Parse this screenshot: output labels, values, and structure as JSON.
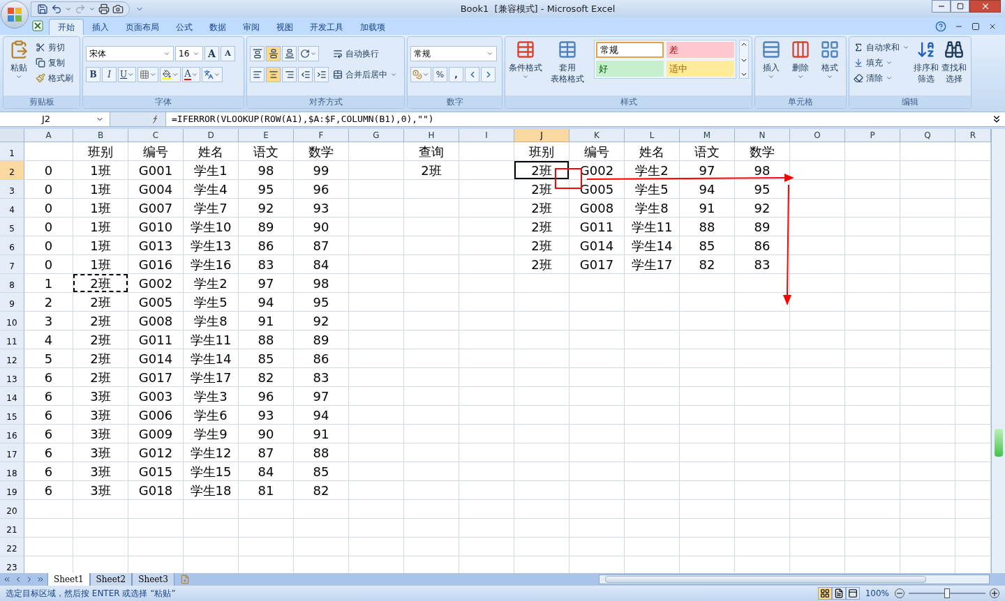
{
  "title_bar": {
    "title": "Book1  [兼容模式] - Microsoft Excel"
  },
  "ribbon_tabs": [
    {
      "label": "开始",
      "selected": true
    },
    {
      "label": "插入",
      "selected": false
    },
    {
      "label": "页面布局",
      "selected": false
    },
    {
      "label": "公式",
      "selected": false
    },
    {
      "label": "数据",
      "selected": false
    },
    {
      "label": "审阅",
      "selected": false
    },
    {
      "label": "视图",
      "selected": false
    },
    {
      "label": "开发工具",
      "selected": false
    },
    {
      "label": "加载项",
      "selected": false
    }
  ],
  "clipboard": {
    "label": "剪贴板",
    "paste": "粘贴",
    "items": [
      "剪切",
      "复制",
      "格式刷"
    ]
  },
  "font": {
    "label": "字体",
    "font_name": "宋体",
    "font_size": "16",
    "grow": "A",
    "shrink": "A",
    "bold": "B",
    "italic": "I",
    "underline": "U",
    "font_color": "A"
  },
  "alignment": {
    "label": "对齐方式",
    "wrap_text": "自动换行",
    "merge_center": "合并后居中"
  },
  "number": {
    "label": "数字",
    "format": "常规",
    "percent": "%",
    "comma": ","
  },
  "styles": {
    "label": "样式",
    "conditional_formatting": "条件格式",
    "format_as_table": [
      "套用",
      "表格格式"
    ],
    "cell_styles": [
      {
        "label": "常规",
        "color": "#ffffff"
      },
      {
        "label": "差",
        "color": "#ffc7ce"
      },
      {
        "label": "好",
        "color": "#c6efce"
      },
      {
        "label": "适中",
        "color": "#ffeb9c"
      }
    ]
  },
  "cells": {
    "label": "单元格",
    "buttons": [
      "插入",
      "删除",
      "格式"
    ]
  },
  "editing": {
    "label": "编辑",
    "items": [
      "自动求和",
      "填充",
      "清除"
    ],
    "sort_filter": [
      "排序和",
      "筛选"
    ],
    "find_select": [
      "查找和",
      "选择"
    ]
  },
  "formula_bar": {
    "name_box": "J2",
    "formula": "=IFERROR(VLOOKUP(ROW(A1),$A:$F,COLUMN(B1),0),\"\")"
  },
  "sheet": {
    "columns": [
      {
        "label": "A",
        "selected": false
      },
      {
        "label": "B",
        "selected": false
      },
      {
        "label": "C",
        "selected": false
      },
      {
        "label": "D",
        "selected": false
      },
      {
        "label": "E",
        "selected": false
      },
      {
        "label": "F",
        "selected": false
      },
      {
        "label": "G",
        "selected": false
      },
      {
        "label": "H",
        "selected": false
      },
      {
        "label": "I",
        "selected": false
      },
      {
        "label": "J",
        "selected": true
      },
      {
        "label": "K",
        "selected": false
      },
      {
        "label": "L",
        "selected": false
      },
      {
        "label": "M",
        "selected": false
      },
      {
        "label": "N",
        "selected": false
      },
      {
        "label": "O",
        "selected": false
      },
      {
        "label": "P",
        "selected": false
      },
      {
        "label": "Q",
        "selected": false
      },
      {
        "label": "R",
        "selected": false
      }
    ],
    "rows": [
      {
        "label": "1",
        "selected": false,
        "cells": {
          "B": "班别",
          "C": "编号",
          "D": "姓名",
          "E": "语文",
          "F": "数学",
          "H": "查询",
          "J": "班别",
          "K": "编号",
          "L": "姓名",
          "M": "语文",
          "N": "数学"
        }
      },
      {
        "label": "2",
        "selected": true,
        "cells": {
          "A": "0",
          "B": "1班",
          "C": "G001",
          "D": "学生1",
          "E": "98",
          "F": "99",
          "H": "2班",
          "J": {
            "text": "2班",
            "active": true,
            "copied": false
          },
          "K": "G002",
          "L": "学生2",
          "M": "97",
          "N": "98"
        }
      },
      {
        "label": "3",
        "selected": false,
        "cells": {
          "A": "0",
          "B": "1班",
          "C": "G004",
          "D": "学生4",
          "E": "95",
          "F": "96",
          "J": "2班",
          "K": "G005",
          "L": "学生5",
          "M": "94",
          "N": "95"
        }
      },
      {
        "label": "4",
        "selected": false,
        "cells": {
          "A": "0",
          "B": "1班",
          "C": "G007",
          "D": "学生7",
          "E": "92",
          "F": "93",
          "J": "2班",
          "K": "G008",
          "L": "学生8",
          "M": "91",
          "N": "92"
        }
      },
      {
        "label": "5",
        "selected": false,
        "cells": {
          "A": "0",
          "B": "1班",
          "C": "G010",
          "D": "学生10",
          "E": "89",
          "F": "90",
          "J": "2班",
          "K": "G011",
          "L": "学生11",
          "M": "88",
          "N": "89"
        }
      },
      {
        "label": "6",
        "selected": false,
        "cells": {
          "A": "0",
          "B": "1班",
          "C": "G013",
          "D": "学生13",
          "E": "86",
          "F": "87",
          "J": "2班",
          "K": "G014",
          "L": "学生14",
          "M": "85",
          "N": "86"
        }
      },
      {
        "label": "7",
        "selected": false,
        "cells": {
          "A": "0",
          "B": "1班",
          "C": "G016",
          "D": "学生16",
          "E": "83",
          "F": "84",
          "J": "2班",
          "K": "G017",
          "L": "学生17",
          "M": "82",
          "N": "83"
        }
      },
      {
        "label": "8",
        "selected": false,
        "cells": {
          "A": "1",
          "B": {
            "text": "2班",
            "active": false,
            "copied": true
          },
          "C": "G002",
          "D": "学生2",
          "E": "97",
          "F": "98"
        }
      },
      {
        "label": "9",
        "selected": false,
        "cells": {
          "A": "2",
          "B": "2班",
          "C": "G005",
          "D": "学生5",
          "E": "94",
          "F": "95"
        }
      },
      {
        "label": "10",
        "selected": false,
        "cells": {
          "A": "3",
          "B": "2班",
          "C": "G008",
          "D": "学生8",
          "E": "91",
          "F": "92"
        }
      },
      {
        "label": "11",
        "selected": false,
        "cells": {
          "A": "4",
          "B": "2班",
          "C": "G011",
          "D": "学生11",
          "E": "88",
          "F": "89"
        }
      },
      {
        "label": "12",
        "selected": false,
        "cells": {
          "A": "5",
          "B": "2班",
          "C": "G014",
          "D": "学生14",
          "E": "85",
          "F": "86"
        }
      },
      {
        "label": "13",
        "selected": false,
        "cells": {
          "A": "6",
          "B": "2班",
          "C": "G017",
          "D": "学生17",
          "E": "82",
          "F": "83"
        }
      },
      {
        "label": "14",
        "selected": false,
        "cells": {
          "A": "6",
          "B": "3班",
          "C": "G003",
          "D": "学生3",
          "E": "96",
          "F": "97"
        }
      },
      {
        "label": "15",
        "selected": false,
        "cells": {
          "A": "6",
          "B": "3班",
          "C": "G006",
          "D": "学生6",
          "E": "93",
          "F": "94"
        }
      },
      {
        "label": "16",
        "selected": false,
        "cells": {
          "A": "6",
          "B": "3班",
          "C": "G009",
          "D": "学生9",
          "E": "90",
          "F": "91"
        }
      },
      {
        "label": "17",
        "selected": false,
        "cells": {
          "A": "6",
          "B": "3班",
          "C": "G012",
          "D": "学生12",
          "E": "87",
          "F": "88"
        }
      },
      {
        "label": "18",
        "selected": false,
        "cells": {
          "A": "6",
          "B": "3班",
          "C": "G015",
          "D": "学生15",
          "E": "84",
          "F": "85"
        }
      },
      {
        "label": "19",
        "selected": false,
        "cells": {
          "A": "6",
          "B": "3班",
          "C": "G018",
          "D": "学生18",
          "E": "81",
          "F": "82"
        }
      },
      {
        "label": "20",
        "selected": false
      },
      {
        "label": "21",
        "selected": false
      },
      {
        "label": "22",
        "selected": false
      },
      {
        "label": "23",
        "selected": false
      }
    ]
  },
  "sheet_tabs": [
    {
      "label": "Sheet1",
      "selected": true
    },
    {
      "label": "Sheet2",
      "selected": false
    },
    {
      "label": "Sheet3",
      "selected": false
    }
  ],
  "status_bar": {
    "message": "选定目标区域，然后按 ENTER 或选择 “粘贴”",
    "views": [
      {
        "selected": true
      },
      {
        "selected": false
      },
      {
        "selected": false
      }
    ],
    "zoom": "100%",
    "zoom_slider": {
      "level": 0.5
    }
  }
}
